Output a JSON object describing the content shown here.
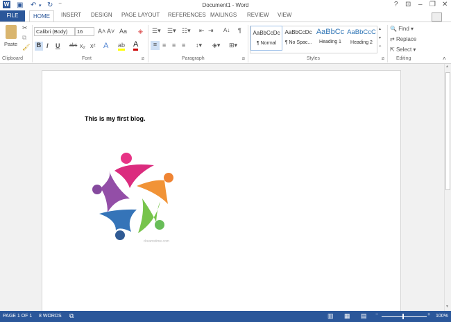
{
  "window": {
    "title": "Document1 - Word",
    "help": "?",
    "restore_ribbon": "⊡",
    "minimize": "–",
    "maximize": "❐",
    "close": "✕"
  },
  "quick_access": {
    "word_icon": "W",
    "save": "💾",
    "undo": "↶",
    "redo": "↻",
    "customize": "⁼"
  },
  "tabs": [
    "FILE",
    "HOME",
    "INSERT",
    "DESIGN",
    "PAGE LAYOUT",
    "REFERENCES",
    "MAILINGS",
    "REVIEW",
    "VIEW"
  ],
  "ribbon": {
    "clipboard": {
      "paste": "Paste",
      "label": "Clipboard"
    },
    "font": {
      "name": "Calibri (Body)",
      "size": "16",
      "grow": "A˄",
      "shrink": "A˅",
      "case": "Aa",
      "bold": "B",
      "italic": "I",
      "underline": "U",
      "strike": "abc",
      "sub": "x₂",
      "sup": "x²",
      "effects": "A",
      "highlight": "ab",
      "color": "A",
      "label": "Font"
    },
    "paragraph": {
      "label": "Paragraph",
      "pilcrow": "¶",
      "sort": "A↓"
    },
    "styles": {
      "label": "Styles",
      "items": [
        {
          "sample": "AaBbCcDc",
          "name": "¶ Normal"
        },
        {
          "sample": "AaBbCcDc",
          "name": "¶ No Spac..."
        },
        {
          "sample": "AaBbCc",
          "name": "Heading 1"
        },
        {
          "sample": "AaBbCcC",
          "name": "Heading 2"
        }
      ]
    },
    "editing": {
      "label": "Editing",
      "find": "Find",
      "replace": "Replace",
      "select": "Select"
    }
  },
  "document": {
    "text": "This is my first blog.",
    "image_watermark": "dreamstime.com"
  },
  "status": {
    "page": "PAGE 1 OF 1",
    "words": "8 WORDS",
    "zoom": "100%",
    "zoom_percent": 100
  },
  "colors": {
    "accent": "#2b579a"
  }
}
